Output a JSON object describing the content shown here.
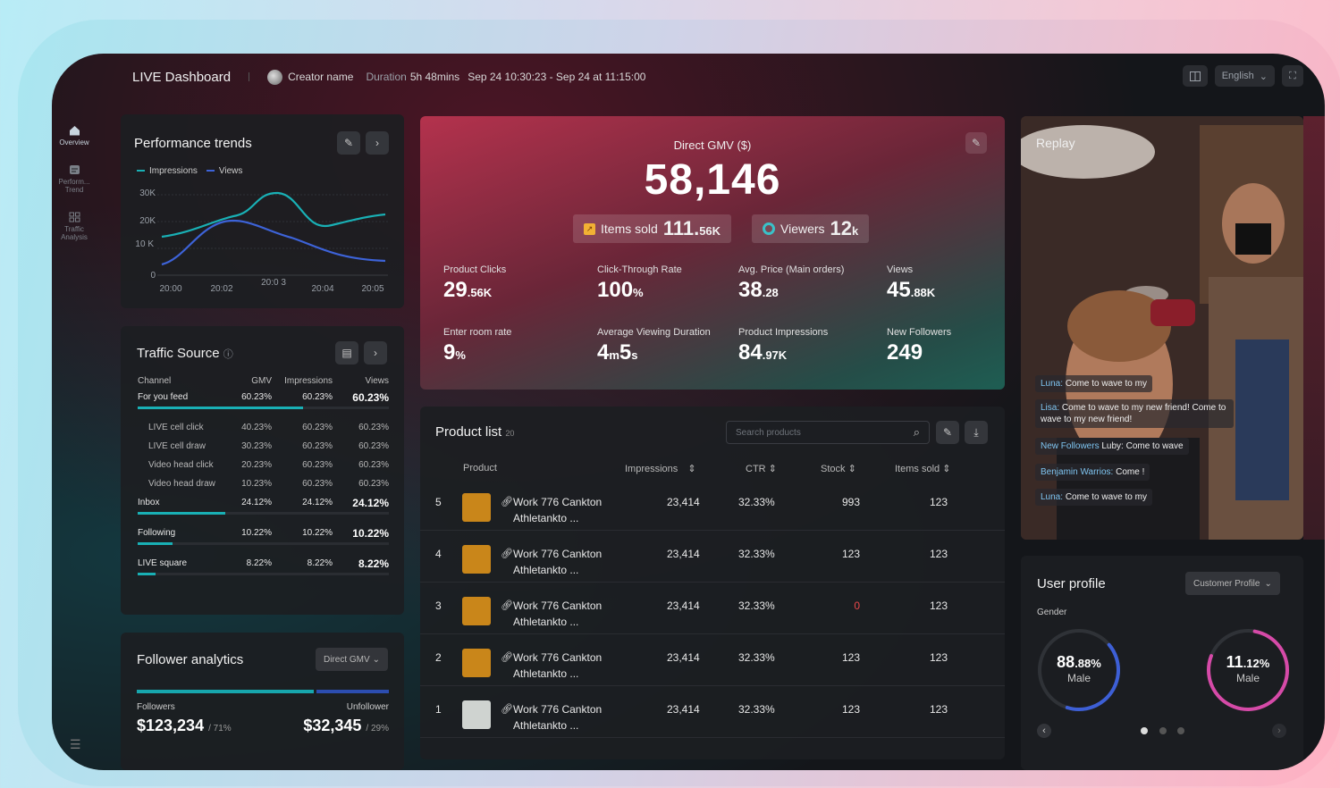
{
  "header": {
    "title": "LIVE Dashboard",
    "creator": "Creator name",
    "duration_label": "Duration",
    "duration_value": "5h 48mins",
    "range": "Sep 24 10:30:23 - Sep 24 at 11:15:00",
    "language": "English"
  },
  "sidebar": {
    "items": [
      {
        "label": "Overview",
        "icon": "home-icon"
      },
      {
        "label": "Perform... Trend",
        "icon": "chart-icon"
      },
      {
        "label": "Traffic Analysis",
        "icon": "grid-icon"
      }
    ]
  },
  "performance": {
    "title": "Performance trends",
    "legend": [
      "Impressions",
      "Views"
    ],
    "y_ticks": [
      "30K",
      "20K",
      "10 K",
      "0"
    ],
    "x_ticks": [
      "20:00",
      "20:02",
      "20:0 3",
      "20:04",
      "20:05"
    ],
    "colors": {
      "impressions": "#19b0b5",
      "views": "#3d63d8"
    }
  },
  "traffic": {
    "title": "Traffic Source",
    "headers": [
      "Channel",
      "GMV",
      "Impressions",
      "Views"
    ],
    "rows": [
      {
        "type": "main",
        "cells": [
          "For you feed",
          "60.23%",
          "60.23%",
          "60.23%"
        ],
        "bar": 0.66
      },
      {
        "type": "sub",
        "cells": [
          "LIVE cell click",
          "40.23%",
          "60.23%",
          "60.23%"
        ]
      },
      {
        "type": "sub",
        "cells": [
          "LIVE cell draw",
          "30.23%",
          "60.23%",
          "60.23%"
        ]
      },
      {
        "type": "sub",
        "cells": [
          "Video head click",
          "20.23%",
          "60.23%",
          "60.23%"
        ]
      },
      {
        "type": "sub",
        "cells": [
          "Video head draw",
          "10.23%",
          "60.23%",
          "60.23%"
        ]
      },
      {
        "type": "main",
        "cells": [
          "Inbox",
          "24.12%",
          "24.12%",
          "24.12%"
        ],
        "bar": 0.35
      },
      {
        "type": "main",
        "cells": [
          "Following",
          "10.22%",
          "10.22%",
          "10.22%"
        ],
        "bar": 0.14
      },
      {
        "type": "main",
        "cells": [
          "LIVE square",
          "8.22%",
          "8.22%",
          "8.22%"
        ],
        "bar": 0.07
      }
    ]
  },
  "follower": {
    "title": "Follower analytics",
    "select": "Direct GMV",
    "followers_label": "Followers",
    "unfollower_label": "Unfollower",
    "followers_value": "$123,234",
    "followers_pct": "/ 71%",
    "unfollower_value": "$32,345",
    "unfollower_pct": "/ 29%",
    "split": 0.71
  },
  "gmv": {
    "title": "Direct GMV ($)",
    "value": "58,146",
    "items_sold_label": "Items sold",
    "items_sold_num": "111.",
    "items_sold_unit": "56K",
    "viewers_label": "Viewers",
    "viewers_num": "12",
    "viewers_unit": "k",
    "metrics": [
      {
        "label": "Product Clicks",
        "num": "29",
        "unit": ".56K"
      },
      {
        "label": "Click-Through Rate",
        "num": "100",
        "unit": "%"
      },
      {
        "label": "Avg. Price (Main orders)",
        "num": "38",
        "unit": ".28"
      },
      {
        "label": "Views",
        "num": "45",
        "unit": ".88K"
      },
      {
        "label": "Enter room rate",
        "num": "9",
        "unit": "%"
      },
      {
        "label": "Average Viewing Duration",
        "num": "4",
        "unit": "m",
        "num2": "5",
        "unit2": "s"
      },
      {
        "label": "Product Impressions",
        "num": "84",
        "unit": ".97K"
      },
      {
        "label": "New Followers",
        "num": "249",
        "unit": ""
      }
    ]
  },
  "products": {
    "title": "Product list",
    "count": "20",
    "search_placeholder": "Search products",
    "headers": [
      "Product",
      "Impressions",
      "CTR",
      "Stock",
      "Items sold"
    ],
    "rows": [
      {
        "rank": "5",
        "name1": "Work 776 Cankton",
        "name2": "Athletankto ...",
        "impressions": "23,414",
        "ctr": "32.33%",
        "stock": "993",
        "sold": "123",
        "stock_alert": false
      },
      {
        "rank": "4",
        "name1": "Work 776 Cankton",
        "name2": "Athletankto ...",
        "impressions": "23,414",
        "ctr": "32.33%",
        "stock": "123",
        "sold": "123",
        "stock_alert": false
      },
      {
        "rank": "3",
        "name1": "Work 776 Cankton",
        "name2": "Athletankto ...",
        "impressions": "23,414",
        "ctr": "32.33%",
        "stock": "0",
        "sold": "123",
        "stock_alert": true
      },
      {
        "rank": "2",
        "name1": "Work 776 Cankton",
        "name2": "Athletankto ...",
        "impressions": "23,414",
        "ctr": "32.33%",
        "stock": "123",
        "sold": "123",
        "stock_alert": false
      },
      {
        "rank": "1",
        "name1": "Work 776 Cankton",
        "name2": "Athletankto ...",
        "impressions": "23,414",
        "ctr": "32.33%",
        "stock": "123",
        "sold": "123",
        "stock_alert": false
      }
    ]
  },
  "replay": {
    "title": "Replay",
    "comments": [
      {
        "who": "Luna:",
        "text": "Come to wave to my"
      },
      {
        "who": "Lisa:",
        "text": "Come to wave to my new friend! Come to wave to my new friend!"
      },
      {
        "who": "New Followers",
        "text": "Luby: Come to wave"
      },
      {
        "who": "Benjamin Warrios:",
        "text": "Come !"
      },
      {
        "who": "Luna:",
        "text": "Come to wave to my"
      }
    ]
  },
  "user_profile": {
    "title": "User profile",
    "select": "Customer Profile",
    "gender_label": "Gender",
    "male": {
      "num": "88",
      "dec": ".88",
      "pct": "%",
      "label": "Male",
      "share": 0.8888
    },
    "female": {
      "num": "11",
      "dec": ".12",
      "pct": "%",
      "label": "Male",
      "share": 0.1112
    }
  }
}
